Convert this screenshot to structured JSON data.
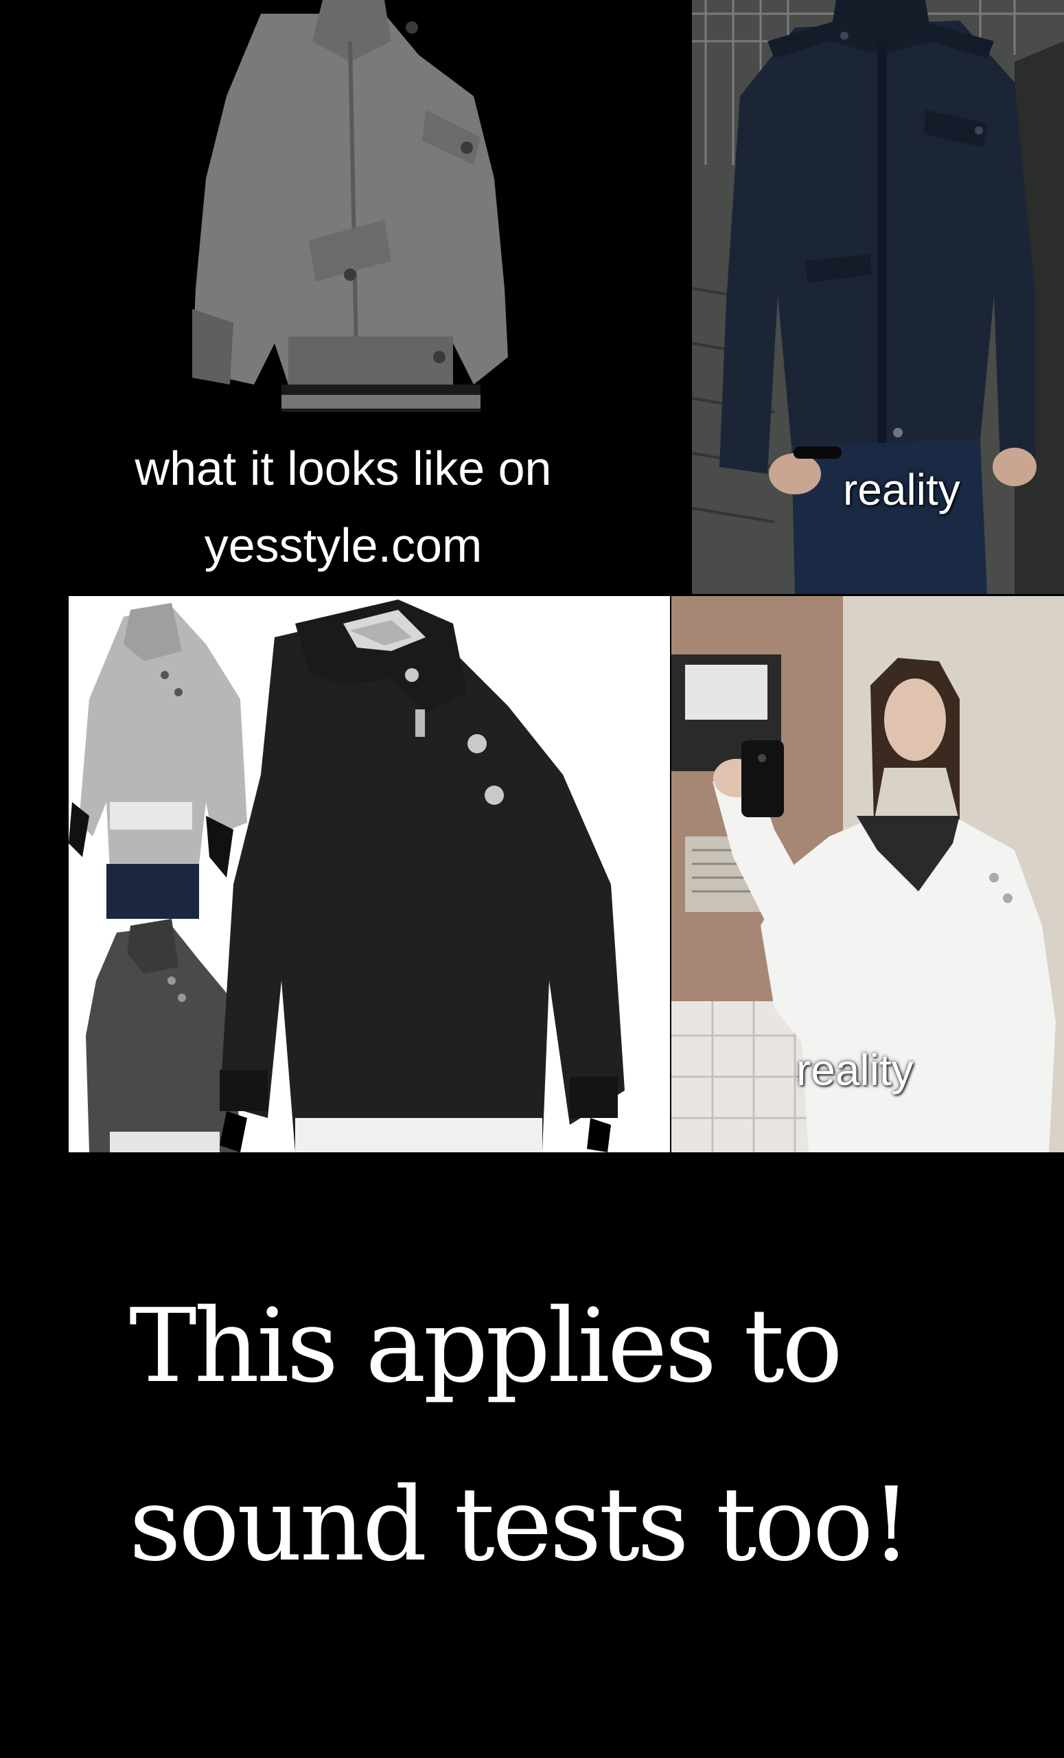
{
  "panels": {
    "top_left": {
      "caption_line1": "what it looks like on",
      "caption_line2": "yesstyle.com"
    },
    "top_right": {
      "caption": "reality"
    },
    "bottom_left": {},
    "bottom_right": {
      "caption": "reality"
    }
  },
  "headline": {
    "line1": "This applies to",
    "line2": "sound tests too!"
  },
  "colors": {
    "background": "#000000",
    "text": "#ffffff"
  }
}
